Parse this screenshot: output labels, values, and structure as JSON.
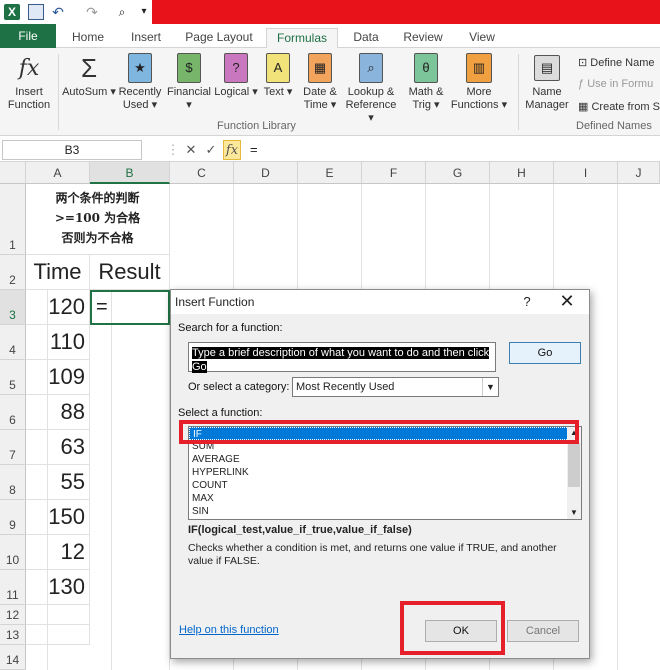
{
  "qat": {
    "icons": [
      "excel-logo-icon",
      "save-icon",
      "undo-icon",
      "redo-icon",
      "print-preview-icon",
      "customize-icon"
    ]
  },
  "tabs": [
    "File",
    "Home",
    "Insert",
    "Page Layout",
    "Formulas",
    "Data",
    "Review",
    "View"
  ],
  "active_tab": "Formulas",
  "ribbon": {
    "insert_function": [
      "Insert",
      "Function"
    ],
    "autosum": [
      "AutoSum"
    ],
    "recently_used": [
      "Recently",
      "Used"
    ],
    "financial": [
      "Financial"
    ],
    "logical": [
      "Logical"
    ],
    "text": [
      "Text"
    ],
    "date_time": [
      "Date &",
      "Time"
    ],
    "lookup": [
      "Lookup &",
      "Reference"
    ],
    "math": [
      "Math &",
      "Trig"
    ],
    "more": [
      "More",
      "Functions"
    ],
    "group_function_library": "Function Library",
    "name_manager": [
      "Name",
      "Manager"
    ],
    "define_name": "Define Name",
    "use_in_formula": "Use in Formu",
    "create_from": "Create from S",
    "group_defined_names": "Defined Names"
  },
  "formula_bar": {
    "name_box": "B3",
    "cancel": "✕",
    "enter": "✓",
    "fx": "fx",
    "content": "="
  },
  "columns": [
    "A",
    "B",
    "C",
    "D",
    "E",
    "F",
    "G",
    "H",
    "I",
    "J"
  ],
  "rows": [
    "1",
    "2",
    "3",
    "4",
    "5",
    "6",
    "7",
    "8",
    "9",
    "10",
    "11",
    "12",
    "13",
    "14"
  ],
  "sheet": {
    "a1_lines": [
      "两个条件的判断",
      ">=100 为合格",
      "否则为不合格"
    ],
    "a2": "Time",
    "b2": "Result",
    "b3": "=",
    "values": [
      "120",
      "110",
      "109",
      "88",
      "63",
      "55",
      "150",
      "12",
      "130"
    ]
  },
  "dialog": {
    "title": "Insert Function",
    "help": "?",
    "close": "✕",
    "search_label": "Search for a function:",
    "search_value": "Type a brief description of what you want to do and then click Go",
    "go": "Go",
    "category_label": "Or select a category:",
    "category_value": "Most Recently Used",
    "select_label": "Select a function:",
    "functions": [
      "IF",
      "SUM",
      "AVERAGE",
      "HYPERLINK",
      "COUNT",
      "MAX",
      "SIN"
    ],
    "selected_function": "IF",
    "syntax": "IF(logical_test,value_if_true,value_if_false)",
    "description": "Checks whether a condition is met, and returns one value if TRUE, and another value if FALSE.",
    "help_link": "Help on this function",
    "ok": "OK",
    "cancel": "Cancel"
  },
  "colors": {
    "excel_green": "#217346",
    "title_red": "#e8121a",
    "highlight_red": "#e5202a",
    "selection_blue": "#0078d7"
  }
}
